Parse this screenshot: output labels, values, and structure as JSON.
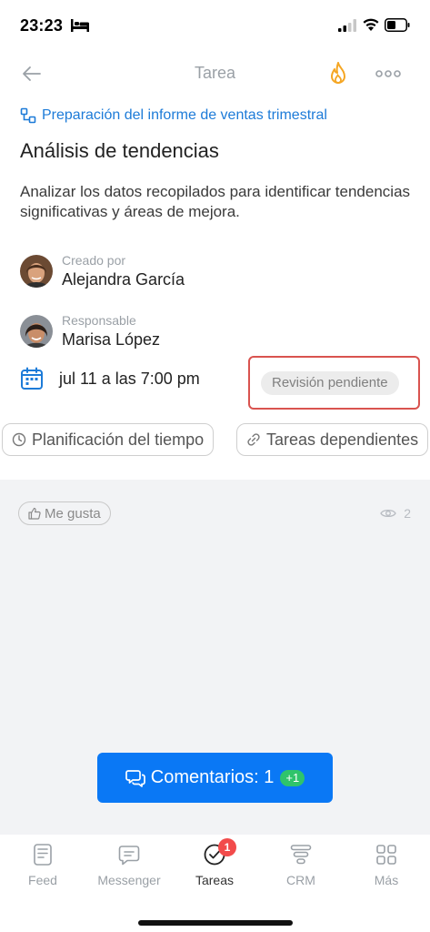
{
  "status_bar": {
    "time": "23:23"
  },
  "nav": {
    "title": "Tarea"
  },
  "task": {
    "parent_task": "Preparación del informe de ventas trimestral",
    "title": "Análisis de tendencias",
    "description": "Analizar los datos recopilados para identificar tendencias significativas y áreas de mejora.",
    "creator_role": "Creado por",
    "creator_name": "Alejandra García",
    "assignee_role": "Responsable",
    "assignee_name": "Marisa López",
    "deadline": "jul 11 a las 7:00 pm",
    "status": "Revisión pendiente"
  },
  "chips": {
    "time_planning": "Planificación del tiempo",
    "dependent_tasks": "Tareas dependientes"
  },
  "feedback": {
    "like_label": "Me gusta",
    "views_count": "2"
  },
  "comments_button": {
    "label": "Comentarios: 1",
    "badge": "+1"
  },
  "tab_bar": {
    "items": [
      {
        "label": "Feed",
        "icon": "feed-icon"
      },
      {
        "label": "Messenger",
        "icon": "messenger-icon"
      },
      {
        "label": "Tareas",
        "icon": "tasks-icon",
        "badge": "1"
      },
      {
        "label": "CRM",
        "icon": "crm-icon"
      },
      {
        "label": "Más",
        "icon": "grid-icon"
      }
    ]
  },
  "colors": {
    "accent": "#0a78f5",
    "link": "#1d7bd8",
    "fire": "#f5a623",
    "highlight_border": "#d9534f",
    "badge_green": "#2fc46b",
    "badge_red": "#f24b4b"
  }
}
